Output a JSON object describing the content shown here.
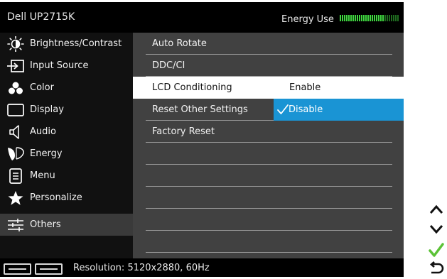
{
  "header": {
    "model": "Dell UP2715K",
    "energy_label": "Energy Use",
    "energy_level": 0.75,
    "energy_color": "#3fd63f"
  },
  "sidebar": {
    "items": [
      {
        "label": "Brightness/Contrast",
        "icon": "brightness-icon"
      },
      {
        "label": "Input Source",
        "icon": "input-source-icon"
      },
      {
        "label": "Color",
        "icon": "color-icon"
      },
      {
        "label": "Display",
        "icon": "display-icon"
      },
      {
        "label": "Audio",
        "icon": "audio-icon"
      },
      {
        "label": "Energy",
        "icon": "energy-icon"
      },
      {
        "label": "Menu",
        "icon": "menu-icon"
      },
      {
        "label": "Personalize",
        "icon": "star-icon"
      },
      {
        "label": "Others",
        "icon": "sliders-icon",
        "selected": true
      }
    ]
  },
  "main": {
    "rows": [
      {
        "label": "Auto Rotate"
      },
      {
        "label": "DDC/CI"
      },
      {
        "label": "LCD Conditioning",
        "highlight": true
      },
      {
        "label": "Reset Other Settings"
      },
      {
        "label": "Factory Reset"
      },
      {
        "label": ""
      },
      {
        "label": ""
      },
      {
        "label": ""
      },
      {
        "label": ""
      },
      {
        "label": ""
      }
    ],
    "options": {
      "enable": "Enable",
      "disable": "Disable",
      "selected": "Disable",
      "accent": "#1a94d4"
    }
  },
  "footer": {
    "resolution": "Resolution: 5120x2880, 60Hz"
  },
  "nav_buttons": [
    "up-arrow-icon",
    "down-arrow-icon",
    "check-icon",
    "back-icon"
  ]
}
